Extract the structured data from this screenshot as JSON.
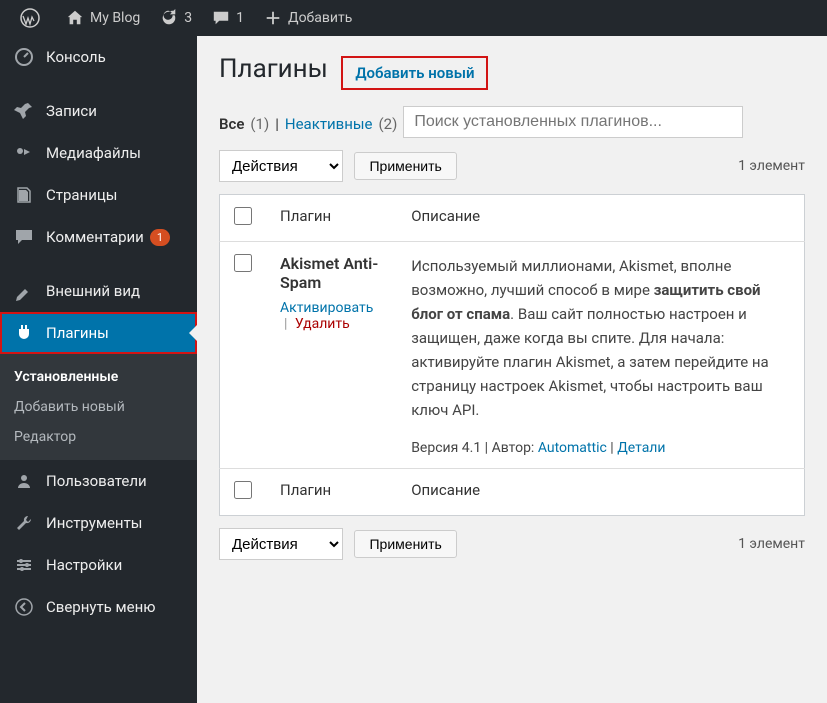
{
  "adminbar": {
    "site_name": "My Blog",
    "updates_count": "3",
    "comments_count": "1",
    "new_content_label": "Добавить"
  },
  "sidebar": {
    "items": [
      {
        "label": "Консоль",
        "icon": "dashboard"
      },
      {
        "label": "Записи",
        "icon": "pin"
      },
      {
        "label": "Медиафайлы",
        "icon": "media"
      },
      {
        "label": "Страницы",
        "icon": "pages"
      },
      {
        "label": "Комментарии",
        "icon": "comments",
        "badge": "1"
      },
      {
        "label": "Внешний вид",
        "icon": "appearance"
      },
      {
        "label": "Плагины",
        "icon": "plugins",
        "current": true,
        "highlight": true
      },
      {
        "label": "Пользователи",
        "icon": "users"
      },
      {
        "label": "Инструменты",
        "icon": "tools"
      },
      {
        "label": "Настройки",
        "icon": "settings"
      },
      {
        "label": "Свернуть меню",
        "icon": "collapse"
      }
    ],
    "submenu": {
      "items": [
        {
          "label": "Установленные",
          "active": true
        },
        {
          "label": "Добавить новый"
        },
        {
          "label": "Редактор"
        }
      ]
    }
  },
  "content": {
    "page_title": "Плагины",
    "add_new_label": "Добавить новый",
    "filters": {
      "all_label": "Все",
      "all_count": "(1)",
      "inactive_label": "Неактивные",
      "inactive_count": "(2)"
    },
    "search_placeholder": "Поиск установленных плагинов...",
    "bulk_action_label": "Действия",
    "apply_label": "Применить",
    "elements_count": "1 элемент",
    "columns": {
      "plugin": "Плагин",
      "description": "Описание"
    },
    "plugins": [
      {
        "name": "Akismet Anti-Spam",
        "activate_label": "Активировать",
        "delete_label": "Удалить",
        "description_pre": "Используемый миллионами, Akismet, вполне возможно, лучший способ в мире ",
        "description_strong": "защитить свой блог от спама",
        "description_post": ". Ваш сайт полностью настроен и защищен, даже когда вы спите. Для начала: активируйте плагин Akismet, а затем перейдите на страницу настроек Akismet, чтобы настроить ваш ключ API.",
        "version_label": "Версия 4.1",
        "author_label": "Автор:",
        "author_name": "Automattic",
        "details_label": "Детали"
      }
    ]
  }
}
